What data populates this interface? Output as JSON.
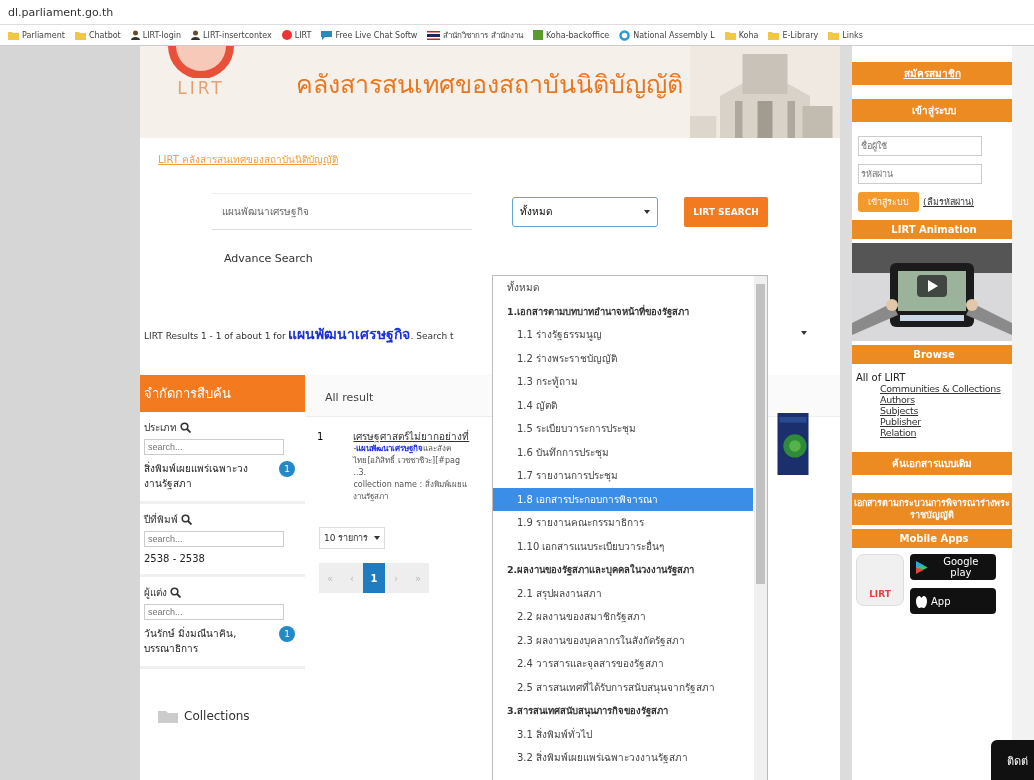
{
  "browser": {
    "address": "dl.parliament.go.th",
    "bookmarks": [
      {
        "label": "Parliament",
        "kind": "folder"
      },
      {
        "label": "Chatbot",
        "kind": "folder"
      },
      {
        "label": "LIRT-login",
        "kind": "user"
      },
      {
        "label": "LIRT-insertcontex",
        "kind": "user"
      },
      {
        "label": "LIRT",
        "kind": "dot"
      },
      {
        "label": "Free Live Chat Softw",
        "kind": "chat"
      },
      {
        "label": "สำนักวิชาการ สำนักงาน",
        "kind": "flag"
      },
      {
        "label": "Koha-backoffice",
        "kind": "koha"
      },
      {
        "label": "National Assembly L",
        "kind": "ring"
      },
      {
        "label": "Koha",
        "kind": "folder"
      },
      {
        "label": "E-Library",
        "kind": "folder"
      },
      {
        "label": "Links",
        "kind": "folder"
      }
    ]
  },
  "header": {
    "logo_text": "LIRT",
    "title": "คลังสารสนเทศของสถาบันนิติบัญญัติ"
  },
  "breadcrumb": "LIRT คลังสารสนเทศของสถาบันนิติบัญญัติ",
  "search": {
    "value": "แผนพัฒนาเศรษฐกิจ",
    "category": "ทั้งหมด",
    "button": "LIRT SEARCH",
    "advanced": "Advance Search"
  },
  "category_menu": [
    {
      "label": "ทั้งหมด",
      "kind": "all",
      "selected": false
    },
    {
      "label": "1.เอกสารตามบทบาทอำนาจหน้าที่ของรัฐสภา",
      "kind": "group",
      "selected": false
    },
    {
      "label": "1.1 ร่างรัฐธรรมนูญ",
      "kind": "item",
      "selected": false
    },
    {
      "label": "1.2 ร่างพระราชบัญญัติ",
      "kind": "item",
      "selected": false
    },
    {
      "label": "1.3 กระทู้ถาม",
      "kind": "item",
      "selected": false
    },
    {
      "label": "1.4 ญัตติ",
      "kind": "item",
      "selected": false
    },
    {
      "label": "1.5 ระเบียบวาระการประชุม",
      "kind": "item",
      "selected": false
    },
    {
      "label": "1.6 บันทึกการประชุม",
      "kind": "item",
      "selected": false
    },
    {
      "label": "1.7 รายงานการประชุม",
      "kind": "item",
      "selected": false
    },
    {
      "label": "1.8 เอกสารประกอบการพิจารณา",
      "kind": "item",
      "selected": true
    },
    {
      "label": "1.9 รายงานคณะกรรมาธิการ",
      "kind": "item",
      "selected": false
    },
    {
      "label": "1.10 เอกสารแนบระเบียบวาระอื่นๆ",
      "kind": "item",
      "selected": false
    },
    {
      "label": "2.ผลงานของรัฐสภาและบุคคลในวงงานรัฐสภา",
      "kind": "group",
      "selected": false
    },
    {
      "label": "2.1 สรุปผลงานสภา",
      "kind": "item",
      "selected": false
    },
    {
      "label": "2.2 ผลงานของสมาชิกรัฐสภา",
      "kind": "item",
      "selected": false
    },
    {
      "label": "2.3 ผลงานของบุคลากรในสังกัดรัฐสภา",
      "kind": "item",
      "selected": false
    },
    {
      "label": "2.4 วารสารและจุลสารของรัฐสภา",
      "kind": "item",
      "selected": false
    },
    {
      "label": "2.5 สารสนเทศที่ได้รับการสนับสนุนจากรัฐสภา",
      "kind": "item",
      "selected": false
    },
    {
      "label": "3.สารสนเทศสนับสนุนภารกิจของรัฐสภา",
      "kind": "group",
      "selected": false
    },
    {
      "label": "3.1 สิ่งพิมพ์ทั่วไป",
      "kind": "item",
      "selected": false
    },
    {
      "label": "3.2 สิ่งพิมพ์เผยแพร่เฉพาะวงงานรัฐสภา",
      "kind": "item",
      "selected": false
    }
  ],
  "results_summary": "LIRT Results 1 - 1 of about 1 for **แผนพัฒนาเศรษฐกิจ**. Search t",
  "filter_title": "จำกัดการสืบค้น",
  "results_tab": "All result",
  "facets": [
    {
      "label": "ประเภท",
      "placeholder": "search...",
      "values": [
        {
          "label": "สิ่งพิมพ์เผยแพร่เฉพาะวงงานรัฐสภา",
          "count": "1"
        }
      ]
    },
    {
      "label": "ปีที่พิมพ์",
      "placeholder": "search...",
      "values": [
        {
          "label": "2538 - 2538"
        }
      ]
    },
    {
      "label": "ผู้แต่ง",
      "placeholder": "search...",
      "values": [
        {
          "label": "วันรักษ์ มิ่งมณีนาคิน, บรรณาธิการ",
          "count": "1"
        }
      ]
    }
  ],
  "results": [
    {
      "number": "1",
      "title": "เศรษฐศาสตร์ไม่ยากอย่างที่",
      "snippet": "-**แผนพัฒนาเศรษฐกิจ**และสังค",
      "lines": [
        "ไทย[อภิสิทธิ์ เวชชาชีวะ][#pag",
        "..3.",
        "collection name : สิ่งพิมพ์เผยแ",
        "งานรัฐสภา"
      ]
    }
  ],
  "page_size": "10 รายการ",
  "pagination": [
    {
      "label": "«",
      "selected": false
    },
    {
      "label": "‹",
      "selected": false
    },
    {
      "label": "1",
      "selected": true
    },
    {
      "label": "›",
      "selected": false
    },
    {
      "label": "»",
      "selected": false
    }
  ],
  "collections": "Collections",
  "sidebar": {
    "register": "สมัครสมาชิก",
    "login_title": "เข้าสู่ระบบ",
    "username_placeholder": "ชื่อผู้ใช้",
    "password_placeholder": "รหัสผ่าน",
    "login_button": "เข้าสู่ระบบ",
    "forgot": "(ลืมรหัสผ่าน)",
    "animation_title": "LIRT Animation",
    "browse_title": "Browse",
    "browse_root": "All of LIRT",
    "browse_links": [
      "Communities & Collections",
      "Authors",
      "Subjects",
      "Publisher",
      "Relation"
    ],
    "old_search": "ค้นเอกสารแบบเดิม",
    "bill_docs": "เอกสารตามกระบวนการพิจารณาร่างพระราชบัญญัติ",
    "apps_title": "Mobile Apps",
    "app_name": "LIRT",
    "google_play": "Google play",
    "app_store": "App"
  },
  "chat_tab": "ติดต่"
}
